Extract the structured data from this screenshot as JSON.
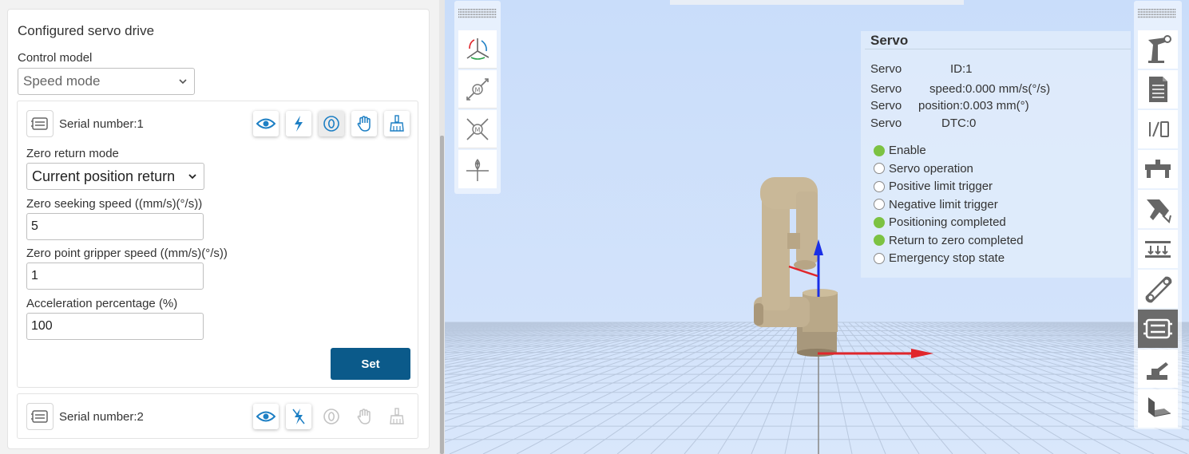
{
  "left": {
    "title": "Configured servo drive",
    "control_model_label": "Control model",
    "control_model_value": "Speed mode",
    "servo1": {
      "serial": "Serial number:1",
      "zero_return_mode_label": "Zero return mode",
      "zero_return_mode_value": "Current position return",
      "zero_seeking_speed_label": "Zero seeking speed ((mm/s)(°/s))",
      "zero_seeking_speed_value": "5",
      "gripper_speed_label": "Zero point gripper speed ((mm/s)(°/s))",
      "gripper_speed_value": "1",
      "acceleration_label": "Acceleration percentage (%)",
      "acceleration_value": "100",
      "set_label": "Set"
    },
    "servo2": {
      "serial": "Serial number:2"
    },
    "tool_icons": [
      "eye-icon",
      "lightning-icon",
      "zero-icon",
      "hand-icon",
      "brush-icon"
    ]
  },
  "servo_info": {
    "title": "Servo",
    "rows": [
      {
        "key": "Servo",
        "label": "ID",
        "value": "1"
      },
      {
        "key": "Servo",
        "label": "speed",
        "value": "0.000 mm/s(°/s)"
      },
      {
        "key": "Servo",
        "label": "position",
        "value": "0.003 mm(°)"
      },
      {
        "key": "Servo",
        "label": "DTC",
        "value": "0"
      }
    ],
    "statuses": [
      {
        "label": "Enable",
        "on": true
      },
      {
        "label": "Servo operation",
        "on": false
      },
      {
        "label": "Positive limit trigger",
        "on": false
      },
      {
        "label": "Negative limit trigger",
        "on": false
      },
      {
        "label": "Positioning completed",
        "on": true
      },
      {
        "label": "Return to zero completed",
        "on": true
      },
      {
        "label": "Emergency stop state",
        "on": false
      }
    ]
  },
  "left_toolbar_icons": [
    "axis-view-icon",
    "motor-translate-icon",
    "motor-expand-icon",
    "position-marker-icon"
  ],
  "right_toolbar_icons": [
    "robot-arm-icon",
    "document-icon",
    "io-icon",
    "gripper-icon",
    "pick-icon",
    "rail-icon",
    "conveyor-icon",
    "servo-drive-icon",
    "base-arm-icon",
    "plane-icon"
  ],
  "colors": {
    "accent": "#0b5a8a",
    "icon_blue": "#1d7fc4",
    "status_on": "#7cc242",
    "viewport_bg": "#cfe1fb"
  }
}
